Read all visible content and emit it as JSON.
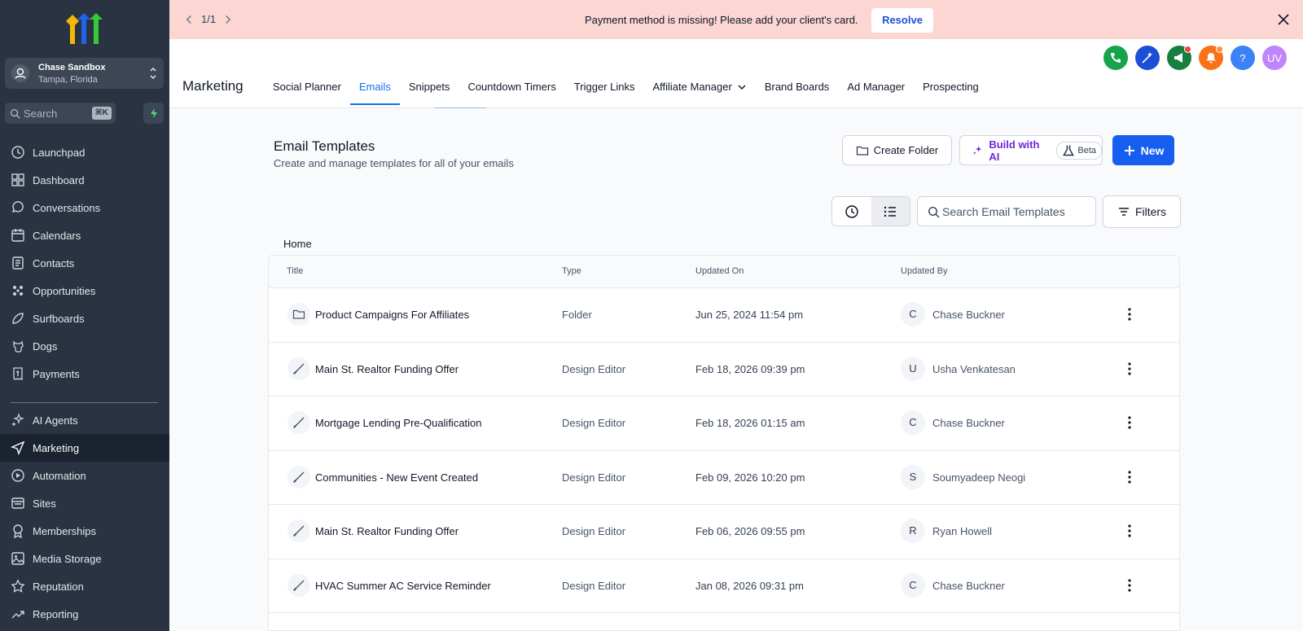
{
  "sidebar": {
    "account": {
      "name": "Chase Sandbox",
      "location": "Tampa, Florida"
    },
    "search": {
      "label": "Search",
      "shortcut": "⌘K"
    },
    "items_top": [
      {
        "label": "Launchpad",
        "icon": "rocket-icon"
      },
      {
        "label": "Dashboard",
        "icon": "grid-icon"
      },
      {
        "label": "Conversations",
        "icon": "chat-icon"
      },
      {
        "label": "Calendars",
        "icon": "calendar-icon"
      },
      {
        "label": "Contacts",
        "icon": "contacts-icon"
      },
      {
        "label": "Opportunities",
        "icon": "opportunities-icon"
      },
      {
        "label": "Surfboards",
        "icon": "surfboard-icon"
      },
      {
        "label": "Dogs",
        "icon": "dog-icon"
      },
      {
        "label": "Payments",
        "icon": "receipt-icon"
      }
    ],
    "items_bottom": [
      {
        "label": "AI Agents",
        "icon": "sparkles-icon"
      },
      {
        "label": "Marketing",
        "icon": "send-icon",
        "active": true
      },
      {
        "label": "Automation",
        "icon": "automation-icon"
      },
      {
        "label": "Sites",
        "icon": "sites-icon"
      },
      {
        "label": "Memberships",
        "icon": "badge-icon"
      },
      {
        "label": "Media Storage",
        "icon": "image-icon"
      },
      {
        "label": "Reputation",
        "icon": "star-icon"
      },
      {
        "label": "Reporting",
        "icon": "trend-icon"
      }
    ]
  },
  "banner": {
    "pager": "1/1",
    "message": "Payment method is missing! Please add your client's card.",
    "resolve_label": "Resolve",
    "background": "#fbd6d3"
  },
  "header": {
    "section": "Marketing",
    "tabs": [
      {
        "label": "Social Planner"
      },
      {
        "label": "Emails",
        "active": true
      },
      {
        "label": "Snippets"
      },
      {
        "label": "Countdown Timers"
      },
      {
        "label": "Trigger Links"
      },
      {
        "label": "Affiliate Manager",
        "dropdown": true
      },
      {
        "label": "Brand Boards"
      },
      {
        "label": "Ad Manager"
      },
      {
        "label": "Prospecting"
      }
    ],
    "user_initials": "UV",
    "help": "?"
  },
  "main": {
    "title": "Email Templates",
    "subtitle": "Create and manage templates for all of your emails",
    "create_folder_label": "Create Folder",
    "build_ai_label": "Build with AI",
    "beta_label": "Beta",
    "new_label": "New",
    "search_placeholder": "Search Email Templates",
    "filters_label": "Filters",
    "breadcrumb": "Home",
    "columns": [
      "Title",
      "Type",
      "Updated On",
      "Updated By"
    ],
    "rows": [
      {
        "title": "Product Campaigns For Affiliates",
        "type": "Folder",
        "updated_on": "Jun 25, 2024 11:54 pm",
        "initial": "C",
        "updated_by": "Chase Buckner",
        "icon": "folder-icon"
      },
      {
        "title": "Main St. Realtor Funding Offer",
        "type": "Design Editor",
        "updated_on": "Feb 18, 2026 09:39 pm",
        "initial": "U",
        "updated_by": "Usha Venkatesan",
        "icon": "brush-icon"
      },
      {
        "title": "Mortgage Lending Pre-Qualification",
        "type": "Design Editor",
        "updated_on": "Feb 18, 2026 01:15 am",
        "initial": "C",
        "updated_by": "Chase Buckner",
        "icon": "brush-icon"
      },
      {
        "title": "Communities - New Event Created",
        "type": "Design Editor",
        "updated_on": "Feb 09, 2026 10:20 pm",
        "initial": "S",
        "updated_by": "Soumyadeep Neogi",
        "icon": "brush-icon"
      },
      {
        "title": "Main St. Realtor Funding Offer",
        "type": "Design Editor",
        "updated_on": "Feb 06, 2026 09:55 pm",
        "initial": "R",
        "updated_by": "Ryan Howell",
        "icon": "brush-icon"
      },
      {
        "title": "HVAC Summer AC Service Reminder",
        "type": "Design Editor",
        "updated_on": "Jan 08, 2026 09:31 pm",
        "initial": "C",
        "updated_by": "Chase Buckner",
        "icon": "brush-icon"
      }
    ]
  },
  "colors": {
    "sidebar": "#2a3341",
    "accent": "#155eef",
    "ai": "#6d28d9"
  }
}
